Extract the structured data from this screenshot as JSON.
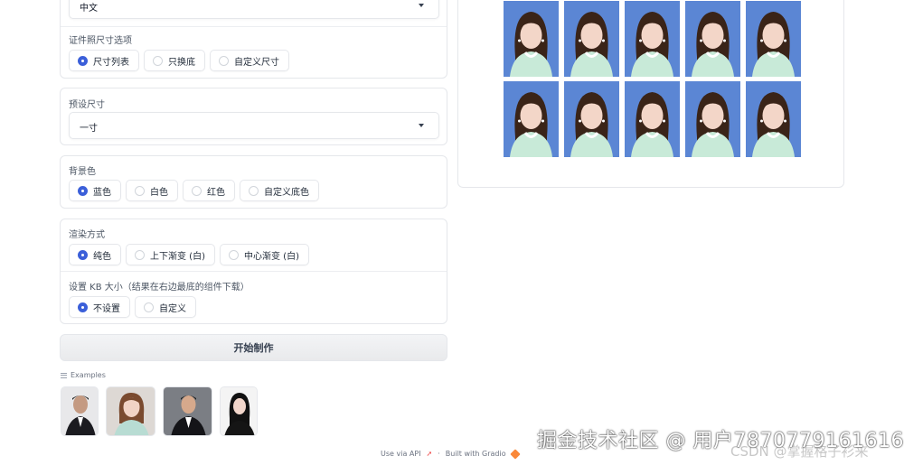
{
  "language": {
    "selected": "中文"
  },
  "size_options": {
    "label": "证件照尺寸选项",
    "options": [
      "尺寸列表",
      "只换底",
      "自定义尺寸"
    ],
    "selected_index": 0
  },
  "preset_size": {
    "label": "预设尺寸",
    "selected": "一寸"
  },
  "background": {
    "label": "背景色",
    "options": [
      "蓝色",
      "白色",
      "红色",
      "自定义底色"
    ],
    "selected_index": 0
  },
  "render": {
    "label": "渲染方式",
    "options": [
      "纯色",
      "上下渐变 (白)",
      "中心渐变 (白)"
    ],
    "selected_index": 0
  },
  "kb_size": {
    "label": "设置 KB 大小（结果在右边最底的组件下载）",
    "options": [
      "不设置",
      "自定义"
    ],
    "selected_index": 0
  },
  "start_button": "开始制作",
  "examples": {
    "label": "Examples",
    "count": 4
  },
  "result": {
    "photo_count": 10,
    "photo_bg": "#5b86d4"
  },
  "footer": {
    "api": "Use via API",
    "built": "Built with Gradio"
  },
  "watermark": "掘金技术社区 @ 用户7870779161616",
  "csdn_mark": "CSDN @掌握格子衫来",
  "colors": {
    "accent": "#3b5fd9",
    "photo_blue": "#5b86d4"
  }
}
